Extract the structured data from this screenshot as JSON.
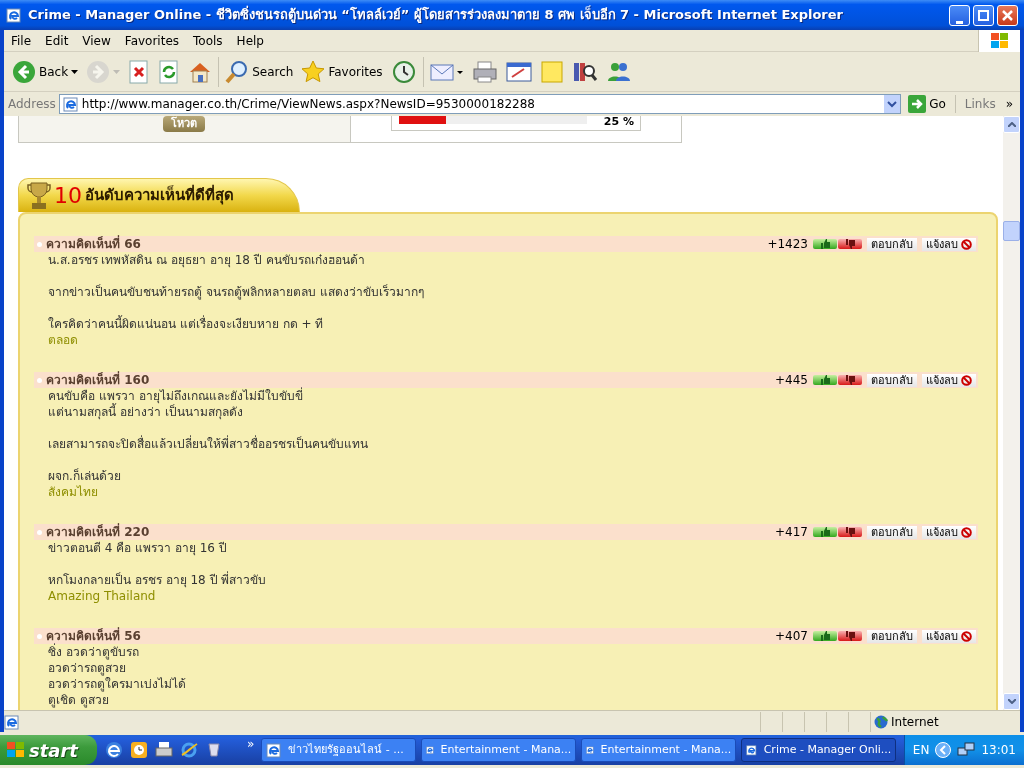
{
  "window": {
    "title": "Crime - Manager Online - ชีวิตซิ่งชนรถตู้บนด่วน “โทลล์เวย์” ผู้โดยสารร่วงลงมาตาย 8 ศพ เจ็บอีก 7 - Microsoft Internet Explorer"
  },
  "menu": [
    "File",
    "Edit",
    "View",
    "Favorites",
    "Tools",
    "Help"
  ],
  "toolbar": [
    {
      "kind": "back",
      "label": "Back",
      "disabled": false
    },
    {
      "kind": "forward",
      "disabled": true
    },
    {
      "kind": "stop",
      "disabled": false
    },
    {
      "kind": "refresh",
      "disabled": false
    },
    {
      "kind": "home",
      "disabled": false
    },
    {
      "kind": "search",
      "label": "Search",
      "disabled": false
    },
    {
      "kind": "favorites",
      "label": "Favorites",
      "disabled": false
    },
    {
      "kind": "history",
      "disabled": false
    },
    {
      "kind": "mail",
      "disabled": false
    },
    {
      "kind": "print",
      "disabled": false
    },
    {
      "kind": "edit",
      "disabled": false
    },
    {
      "kind": "note",
      "disabled": false
    },
    {
      "kind": "research",
      "disabled": false
    },
    {
      "kind": "messenger",
      "disabled": false
    }
  ],
  "address_bar": {
    "label": "Address",
    "url": "http://www.manager.co.th/Crime/ViewNews.aspx?NewsID=9530000182288",
    "go": "Go",
    "links": "Links",
    "more": "»"
  },
  "poll": {
    "vote_button": "โหวต",
    "level": 0.25,
    "percent": "25 %"
  },
  "top_comments": {
    "rank": "10",
    "title": "อันดับความเห็นที่ดีที่สุด",
    "comments": [
      {
        "title": "ความคิดเห็นที่ 66",
        "score": "+1423",
        "reply": "ตอบกลับ",
        "report": "แจ้งลบ",
        "paragraphs": [
          [
            "น.ส.อรชร เทพหัสดิน ณ อยุธยา อายุ 18 ปี คนขับรถเก๋งฮอนด้า"
          ],
          [
            "จากข่าวเป็นคนขับชนท้ายรถตู้ จนรถตู้พลิกหลายตลบ แสดงว่าขับเร็วมากๆ"
          ],
          [
            "ใครคิดว่าคนนี้ผิดแน่นอน แต่เรื่องจะเงียบหาย กด + ที"
          ]
        ],
        "author": "ตลอด"
      },
      {
        "title": "ความคิดเห็นที่ 160",
        "score": "+445",
        "reply": "ตอบกลับ",
        "report": "แจ้งลบ",
        "paragraphs": [
          [
            "คนขับคือ แพรวา อายุไม่ถึงเกณและยังไม่มีใบขับขี่",
            "แต่นามสกุลนี้ อย่างว่า เป็นนามสกุลดัง"
          ],
          [
            "เลยสามารถจะปิดสื่อแล้วเปลี่ยนให้พี่สาวชื่ออรชรเป็นคนขับแทน"
          ],
          [
            "ผจก.ก็เล่นด้วย"
          ]
        ],
        "author": "สังคมไทย"
      },
      {
        "title": "ความคิดเห็นที่ 220",
        "score": "+417",
        "reply": "ตอบกลับ",
        "report": "แจ้งลบ",
        "paragraphs": [
          [
            "ข่าวตอนตี 4 คือ แพรวา อายุ 16 ปี"
          ],
          [
            "หกโมงกลายเป็น อรชร อายุ 18 ปี พี่สาวขับ"
          ]
        ],
        "author": "Amazing Thailand"
      },
      {
        "title": "ความคิดเห็นที่ 56",
        "score": "+407",
        "reply": "ตอบกลับ",
        "report": "แจ้งลบ",
        "paragraphs": [
          [
            "ซิ่ง อวดว่าตูขับรถ",
            "อวดว่ารถตูสวย",
            "อวดว่ารถตูใครมาเบ่งไม่ได้",
            "ตูเชิด ตูสวย"
          ]
        ]
      }
    ]
  },
  "status_bar": {
    "zone": "Internet"
  },
  "taskbar": {
    "start": "start",
    "more": "»",
    "tasks": [
      {
        "label": "ข่าวไทยรัฐออนไลน์ - ...",
        "selected": false
      },
      {
        "label": "Entertainment - Mana...",
        "selected": false
      },
      {
        "label": "Entertainment - Mana...",
        "selected": false
      },
      {
        "label": "Crime - Manager Onli...",
        "selected": true
      }
    ],
    "language": "EN",
    "clock": "13:01"
  }
}
